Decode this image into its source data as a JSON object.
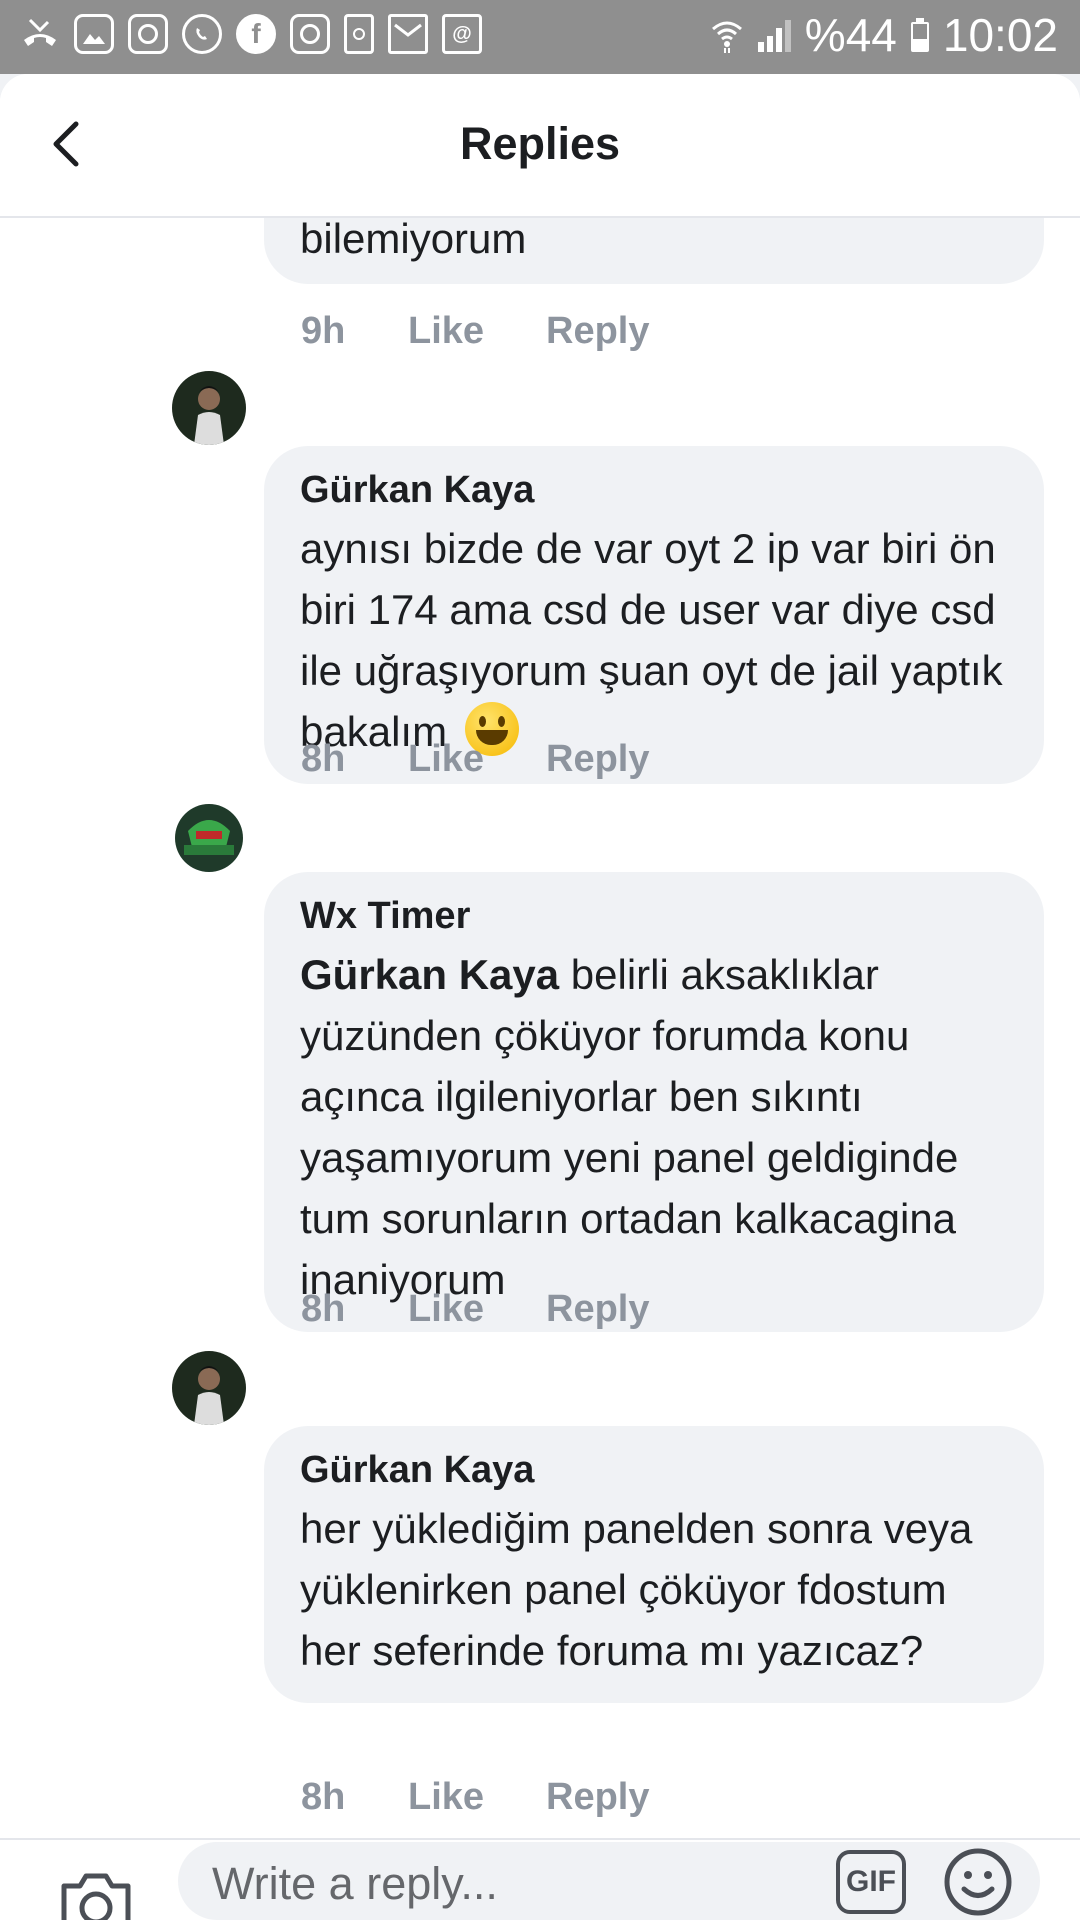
{
  "status_bar": {
    "battery": "%44",
    "time": "10:02",
    "battery_level": 0.44,
    "notification_icons": [
      "missed-call-icon",
      "gallery-icon",
      "instagram-icon",
      "whatsapp-icon",
      "facebook-icon",
      "instagram-icon",
      "clipboard-icon",
      "email-icon",
      "photo-email-icon"
    ]
  },
  "header": {
    "title": "Replies"
  },
  "partial_comment": {
    "text": "bilemiyorum",
    "time": "9h",
    "like": "Like",
    "reply": "Reply"
  },
  "comments": [
    {
      "author": "Gürkan Kaya",
      "text": "aynısı bizde de var oyt 2 ip var biri ön biri 174 ama csd de user var diye csd ile uğraşıyorum şuan oyt de jail yaptık bakalım",
      "emoji": "grinning-face",
      "time": "8h",
      "like": "Like",
      "reply": "Reply"
    },
    {
      "author": "Wx Timer",
      "mention": "Gürkan Kaya",
      "text": "belirli aksaklıklar yüzünden çöküyor forumda konu açınca ilgileniyorlar ben sıkıntı yaşamıyorum yeni panel geldiginde tum sorunların ortadan kalkacagina inaniyorum",
      "time": "8h",
      "like": "Like",
      "reply": "Reply"
    },
    {
      "author": "Gürkan Kaya",
      "text": "her yüklediğim panelden sonra veya yüklenirken panel çöküyor fdostum her seferinde foruma mı yazıcaz?",
      "time": "8h",
      "like": "Like",
      "reply": "Reply"
    }
  ],
  "composer": {
    "placeholder": "Write a reply...",
    "gif_label": "GIF"
  },
  "colors": {
    "bubble": "#f0f2f5",
    "meta": "#8d949e",
    "text": "#1c1e21",
    "status_bar": "#8f8f8f"
  }
}
